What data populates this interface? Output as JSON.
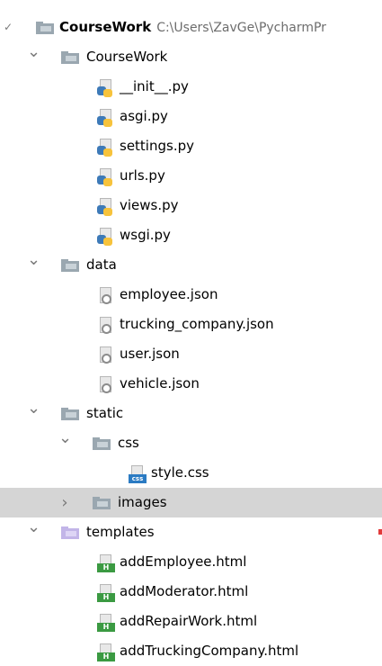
{
  "root": {
    "name": "CourseWork",
    "path": "C:\\Users\\ZavGe\\PycharmPr"
  },
  "rows": [
    {
      "label": "CourseWork",
      "kind": "folder",
      "depth": 1,
      "expanded": true
    },
    {
      "label": "__init__.py",
      "kind": "py",
      "depth": 2
    },
    {
      "label": "asgi.py",
      "kind": "py",
      "depth": 2
    },
    {
      "label": "settings.py",
      "kind": "py",
      "depth": 2
    },
    {
      "label": "urls.py",
      "kind": "py",
      "depth": 2
    },
    {
      "label": "views.py",
      "kind": "py",
      "depth": 2
    },
    {
      "label": "wsgi.py",
      "kind": "py",
      "depth": 2
    },
    {
      "label": "data",
      "kind": "folder",
      "depth": 1,
      "expanded": true
    },
    {
      "label": "employee.json",
      "kind": "json",
      "depth": 2
    },
    {
      "label": "trucking_company.json",
      "kind": "json",
      "depth": 2
    },
    {
      "label": "user.json",
      "kind": "json",
      "depth": 2
    },
    {
      "label": "vehicle.json",
      "kind": "json",
      "depth": 2
    },
    {
      "label": "static",
      "kind": "folder",
      "depth": 1,
      "expanded": true
    },
    {
      "label": "css",
      "kind": "folder",
      "depth": 2,
      "expanded": true
    },
    {
      "label": "style.css",
      "kind": "css",
      "depth": 3
    },
    {
      "label": "images",
      "kind": "folder",
      "depth": 2,
      "expanded": false,
      "selected": true
    },
    {
      "label": "templates",
      "kind": "folder-purple",
      "depth": 1,
      "expanded": true
    },
    {
      "label": "addEmployee.html",
      "kind": "html",
      "depth": 2
    },
    {
      "label": "addModerator.html",
      "kind": "html",
      "depth": 2
    },
    {
      "label": "addRepairWork.html",
      "kind": "html",
      "depth": 2
    },
    {
      "label": "addTruckingCompany.html",
      "kind": "html",
      "depth": 2
    }
  ],
  "icons": {
    "expanded": "chevron-down-icon",
    "collapsed": "chevron-right-icon"
  },
  "colors": {
    "selection": "#d5d5d5",
    "folder": "#9aa7b0",
    "templates_folder": "#c2b5e8",
    "python_blue": "#3d7ab8",
    "python_yellow": "#f7c33c",
    "html_green": "#3b9a42",
    "css_blue": "#2b7bc3",
    "marker": "#e23b3b"
  }
}
